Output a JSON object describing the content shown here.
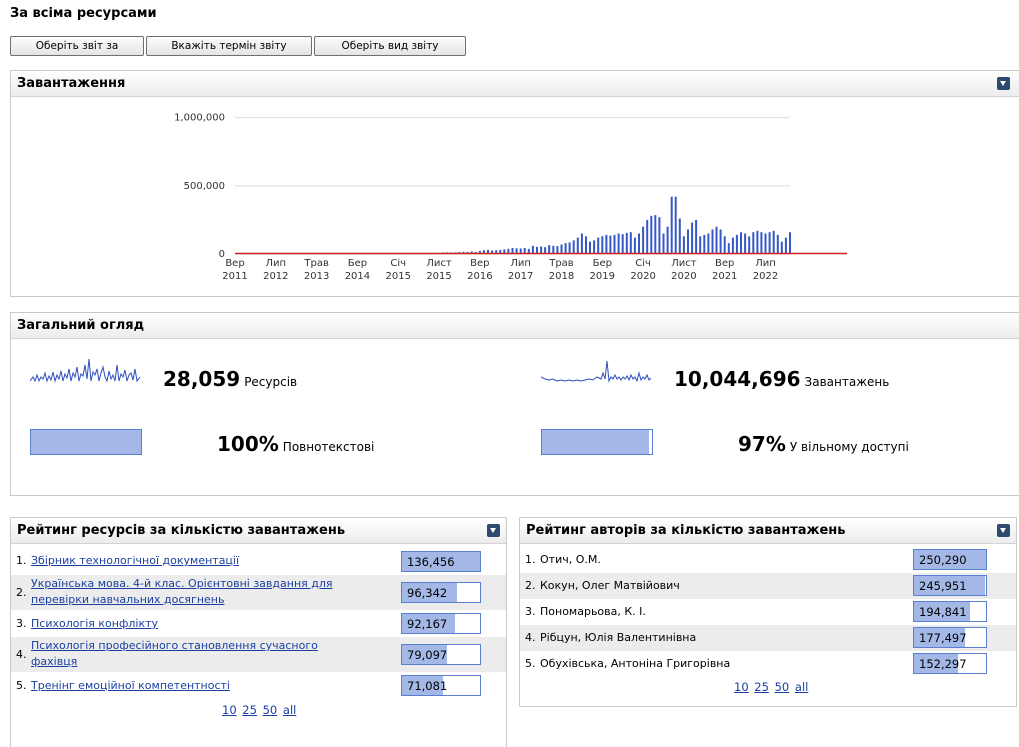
{
  "page_title": "За всіма ресурсами",
  "buttons": {
    "report_for": "Оберіть звіт за",
    "report_period": "Вкажіть термін звіту",
    "report_type": "Оберіть вид звіту"
  },
  "downloads_panel": {
    "title": "Завантаження"
  },
  "overview_panel": {
    "title": "Загальний огляд",
    "resources_value": "28,059",
    "resources_label": "Ресурсів",
    "downloads_value": "10,044,696",
    "downloads_label": "Завантажень",
    "fulltext_value": "100%",
    "fulltext_label": "Повнотекстові",
    "fulltext_fraction": 1.0,
    "open_value": "97%",
    "open_label": "У вільному доступі",
    "open_fraction": 0.97
  },
  "resources_rank": {
    "title": "Рейтинг ресурсів за кількістю завантажень",
    "items": [
      {
        "n": "1.",
        "lines": [
          "Збірник технологічної документації"
        ],
        "value": "136,456",
        "raw": 136456
      },
      {
        "n": "2.",
        "lines": [
          "Українська мова. 4-й клас. Орієнтовні завдання для",
          "перевірки навчальних досягнень"
        ],
        "value": "96,342",
        "raw": 96342
      },
      {
        "n": "3.",
        "lines": [
          "Психологія конфлікту"
        ],
        "value": "92,167",
        "raw": 92167
      },
      {
        "n": "4.",
        "lines": [
          "Психологія професійного становлення сучасного",
          "фахівця"
        ],
        "value": "79,097",
        "raw": 79097
      },
      {
        "n": "5.",
        "lines": [
          "Тренінг емоційної компетентності"
        ],
        "value": "71,081",
        "raw": 71081
      }
    ],
    "pager": [
      "10",
      "25",
      "50",
      "all"
    ]
  },
  "authors_rank": {
    "title": "Рейтинг авторів за кількістю завантажень",
    "items": [
      {
        "n": "1.",
        "name": "Отич, О.М.",
        "value": "250,290",
        "raw": 250290
      },
      {
        "n": "2.",
        "name": "Кокун, Олег Матвійович",
        "value": "245,951",
        "raw": 245951
      },
      {
        "n": "3.",
        "name": "Пономарьова, К. І.",
        "value": "194,841",
        "raw": 194841
      },
      {
        "n": "4.",
        "name": "Рібцун, Юлія Валентинівна",
        "value": "177,497",
        "raw": 177497
      },
      {
        "n": "5.",
        "name": "Обухівська, Антоніна Григорівна",
        "value": "152,297",
        "raw": 152297
      }
    ],
    "pager": [
      "10",
      "25",
      "50",
      "all"
    ]
  },
  "chart_data": {
    "type": "bar",
    "title": "Завантаження",
    "xlabel": "",
    "ylabel": "",
    "ylim": [
      0,
      1100000
    ],
    "yticks": [
      {
        "value": 0,
        "label": "0"
      },
      {
        "value": 500000,
        "label": "500,000"
      },
      {
        "value": 1000000,
        "label": "1,000,000"
      }
    ],
    "xticks": [
      {
        "line1": "Вер",
        "line2": "2011",
        "month": 0
      },
      {
        "line1": "Лип",
        "line2": "2012",
        "month": 10
      },
      {
        "line1": "Трав",
        "line2": "2013",
        "month": 20
      },
      {
        "line1": "Бер",
        "line2": "2014",
        "month": 30
      },
      {
        "line1": "Січ",
        "line2": "2015",
        "month": 40
      },
      {
        "line1": "Лист",
        "line2": "2015",
        "month": 50
      },
      {
        "line1": "Вер",
        "line2": "2016",
        "month": 60
      },
      {
        "line1": "Лип",
        "line2": "2017",
        "month": 70
      },
      {
        "line1": "Трав",
        "line2": "2018",
        "month": 80
      },
      {
        "line1": "Бер",
        "line2": "2019",
        "month": 90
      },
      {
        "line1": "Січ",
        "line2": "2020",
        "month": 100
      },
      {
        "line1": "Лист",
        "line2": "2020",
        "month": 110
      },
      {
        "line1": "Вер",
        "line2": "2021",
        "month": 120
      },
      {
        "line1": "Лип",
        "line2": "2022",
        "month": 130
      }
    ],
    "grid": true,
    "series": [
      {
        "color": "#3558c7",
        "values": [
          0,
          0,
          0,
          0,
          0,
          0,
          0,
          0,
          0,
          0,
          0,
          0,
          0,
          0,
          0,
          0,
          0,
          0,
          0,
          0,
          0,
          0,
          0,
          0,
          0,
          0,
          0,
          0,
          0,
          0,
          0,
          0,
          0,
          0,
          0,
          0,
          0,
          0,
          0,
          0,
          0,
          0,
          0,
          0,
          0,
          2000,
          3000,
          4000,
          5000,
          6000,
          8000,
          10000,
          12000,
          10000,
          12000,
          14000,
          16000,
          15000,
          18000,
          15000,
          22000,
          28000,
          30000,
          25000,
          28000,
          30000,
          34000,
          38000,
          45000,
          42000,
          40000,
          45000,
          38000,
          60000,
          52000,
          55000,
          50000,
          65000,
          60000,
          58000,
          70000,
          80000,
          85000,
          100000,
          120000,
          150000,
          130000,
          90000,
          100000,
          120000,
          130000,
          140000,
          135000,
          140000,
          150000,
          145000,
          155000,
          160000,
          120000,
          150000,
          200000,
          250000,
          280000,
          285000,
          270000,
          150000,
          200000,
          420000,
          420000,
          260000,
          130000,
          180000,
          230000,
          250000,
          130000,
          140000,
          150000,
          180000,
          200000,
          180000,
          130000,
          80000,
          120000,
          140000,
          160000,
          150000,
          130000,
          160000,
          170000,
          160000,
          150000,
          160000,
          170000,
          140000,
          90000,
          120000,
          160000
        ]
      },
      {
        "color": "#d02020",
        "values": [
          0,
          0,
          0,
          0,
          0,
          0,
          0,
          0,
          0,
          0,
          0,
          0,
          0,
          0,
          0,
          0,
          0,
          0,
          0,
          0,
          0,
          0,
          0,
          0,
          0,
          0,
          0,
          0,
          0,
          0,
          0,
          0,
          0,
          0,
          0,
          0,
          0,
          0,
          0,
          0,
          0,
          0,
          0,
          0,
          0,
          0,
          0,
          0,
          0,
          0,
          0,
          0,
          0,
          0,
          0,
          0,
          0,
          0,
          0,
          0,
          0,
          0,
          0,
          0,
          0,
          0,
          0,
          0,
          0,
          0,
          0,
          0,
          0,
          0,
          0,
          0,
          0,
          0,
          0,
          0,
          0,
          0,
          0,
          0,
          0,
          0,
          0,
          0,
          0,
          0,
          0,
          0,
          0,
          0,
          0,
          0,
          0,
          0,
          0,
          0,
          0,
          0,
          0,
          0,
          0,
          0,
          0,
          0,
          0,
          0,
          0,
          0,
          0,
          0,
          0,
          0,
          0,
          0,
          0,
          0,
          0,
          0,
          0,
          0,
          0,
          0,
          0,
          0,
          0,
          0,
          0,
          0,
          0,
          0,
          0,
          0,
          0,
          0,
          0,
          0,
          0,
          0,
          0,
          0,
          0,
          0,
          0,
          0,
          0,
          0,
          0
        ]
      }
    ]
  }
}
